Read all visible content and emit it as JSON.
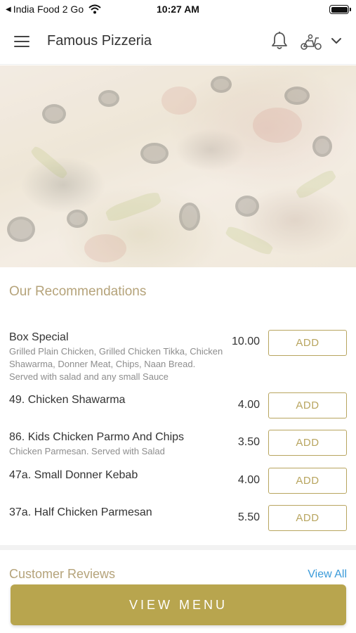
{
  "status_bar": {
    "carrier": "India Food 2 Go",
    "time": "10:27 AM"
  },
  "header": {
    "title": "Famous Pizzeria",
    "icons": [
      "menu-icon",
      "bell-icon",
      "scooter-icon",
      "chevron-down-icon"
    ]
  },
  "recommendations": {
    "title": "Our Recommendations",
    "items": [
      {
        "name": "Box Special",
        "description": "Grilled Plain Chicken, Grilled Chicken Tikka, Chicken Shawarma, Donner Meat, Chips, Naan Bread. Served with salad and any small Sauce",
        "price": "10.00",
        "button": "ADD"
      },
      {
        "name": "49. Chicken Shawarma",
        "description": "",
        "price": "4.00",
        "button": "ADD"
      },
      {
        "name": "86. Kids Chicken Parmo And Chips",
        "description": "Chicken Parmesan. Served with Salad",
        "price": "3.50",
        "button": "ADD"
      },
      {
        "name": "47a. Small Donner Kebab",
        "description": "",
        "price": "4.00",
        "button": "ADD"
      },
      {
        "name": "37a. Half Chicken Parmesan",
        "description": "",
        "price": "5.50",
        "button": "ADD"
      }
    ]
  },
  "reviews": {
    "title": "Customer Reviews",
    "view_all": "View All"
  },
  "footer": {
    "view_menu": "VIEW MENU"
  },
  "colors": {
    "accent_gold": "#b8a54e",
    "section_title": "#b5a37a",
    "link_blue": "#3a9ad9"
  }
}
